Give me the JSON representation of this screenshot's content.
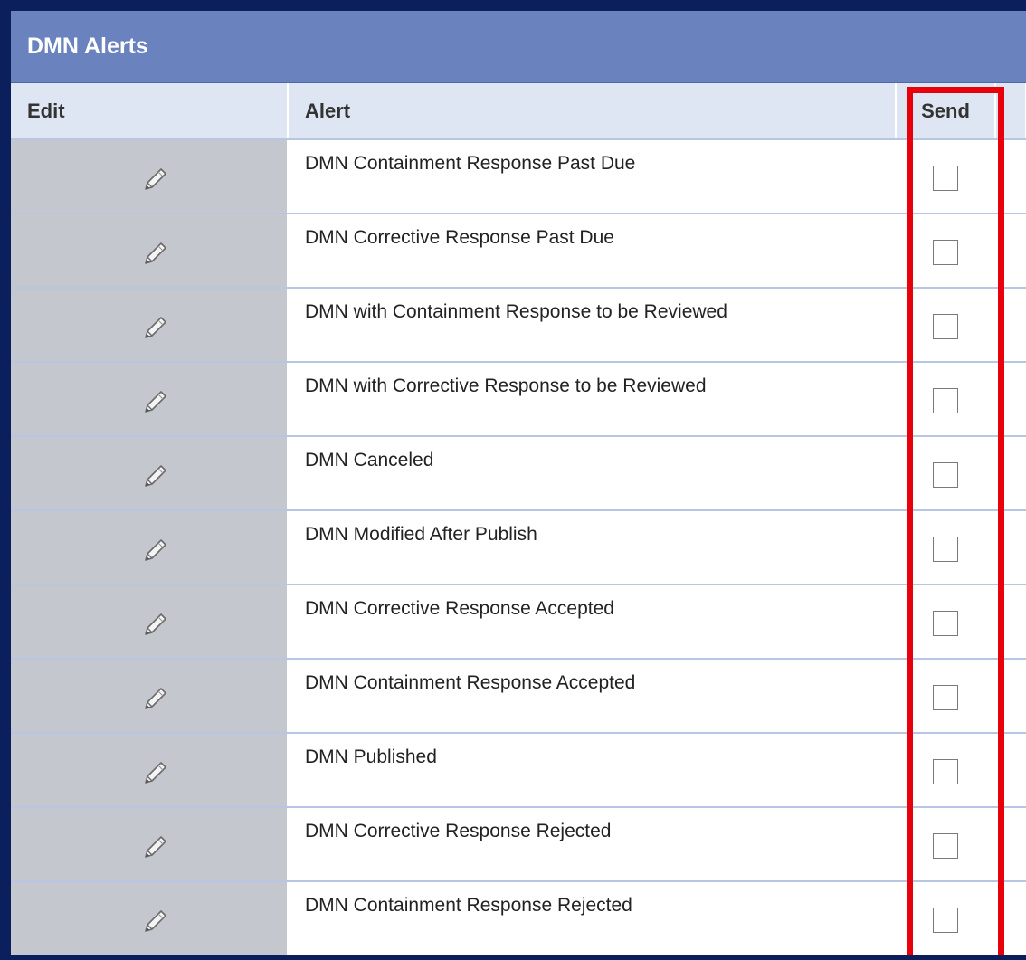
{
  "panel": {
    "title": "DMN Alerts"
  },
  "columns": {
    "edit": "Edit",
    "alert": "Alert",
    "send": "Send"
  },
  "icons": {
    "edit": "pencil-icon"
  },
  "colors": {
    "header_bg": "#6a82bd",
    "highlight": "#e8000b",
    "frame": "#0a1f5c"
  },
  "rows": [
    {
      "alert": "DMN Containment Response Past Due",
      "send": false
    },
    {
      "alert": "DMN Corrective Response Past Due",
      "send": false
    },
    {
      "alert": "DMN with Containment Response to be Reviewed",
      "send": false
    },
    {
      "alert": "DMN with Corrective Response to be Reviewed",
      "send": false
    },
    {
      "alert": "DMN Canceled",
      "send": false
    },
    {
      "alert": "DMN Modified After Publish",
      "send": false
    },
    {
      "alert": "DMN Corrective Response Accepted",
      "send": false
    },
    {
      "alert": "DMN Containment Response Accepted",
      "send": false
    },
    {
      "alert": "DMN Published",
      "send": false
    },
    {
      "alert": "DMN Corrective Response Rejected",
      "send": false
    },
    {
      "alert": "DMN Containment Response Rejected",
      "send": false
    }
  ]
}
